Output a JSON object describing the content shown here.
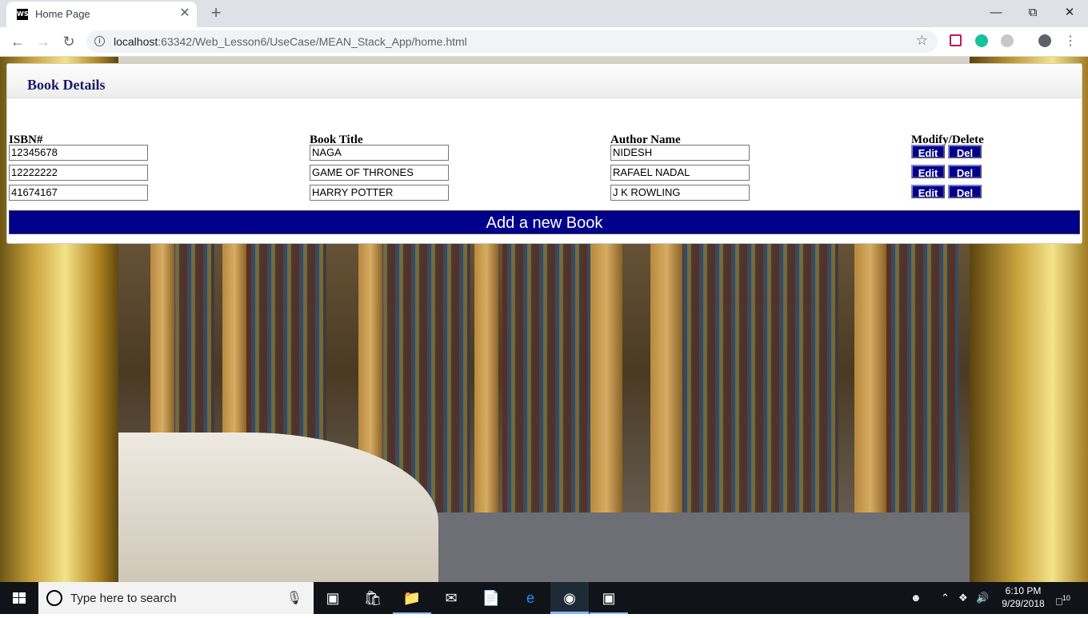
{
  "browser": {
    "tab_title": "Home Page",
    "favicon_text": "WS",
    "url_host": "localhost",
    "url_rest": ":63342/Web_Lesson6/UseCase/MEAN_Stack_App/home.html"
  },
  "page": {
    "panel_title": "Book Details",
    "columns": [
      "ISBN#",
      "Book Title",
      "Author Name",
      "Modify/Delete"
    ],
    "rows": [
      {
        "isbn": "12345678",
        "title": "NAGA",
        "author": "NIDESH"
      },
      {
        "isbn": "12222222",
        "title": "GAME OF THRONES",
        "author": "RAFAEL NADAL"
      },
      {
        "isbn": "41674167",
        "title": "HARRY POTTER",
        "author": "J K ROWLING"
      }
    ],
    "edit_label": "Edit",
    "del_label": "Del",
    "add_label": "Add a new Book",
    "colors": {
      "button_bg": "#00008b",
      "title_color": "#1a1a6e"
    }
  },
  "taskbar": {
    "search_placeholder": "Type here to search",
    "time": "6:10 PM",
    "date": "9/29/2018",
    "notification_count": "10"
  }
}
